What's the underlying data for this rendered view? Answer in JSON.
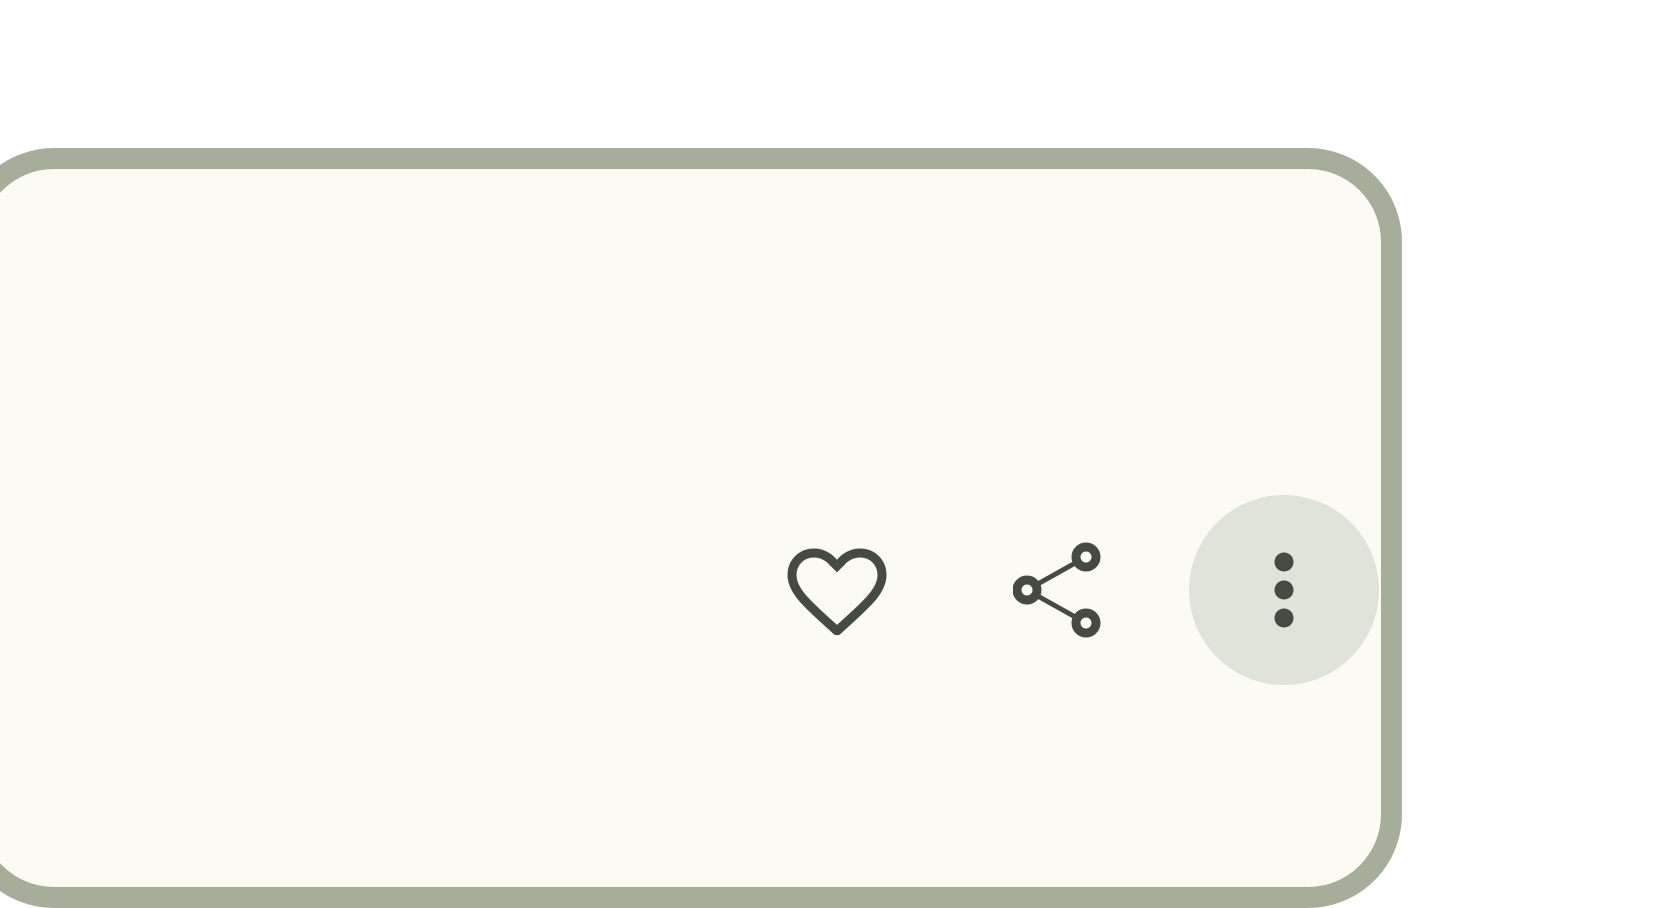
{
  "colors": {
    "page_background": "#ffffff",
    "card_background": "#fbfbf4",
    "card_border": "#a6ae9b",
    "icon_color": "#464b41",
    "more_button_background": "#e0e3d7"
  },
  "actions": [
    {
      "id": "favorite",
      "icon": "heart-outline-icon"
    },
    {
      "id": "share",
      "icon": "share-icon"
    },
    {
      "id": "more",
      "icon": "more-vertical-icon"
    }
  ]
}
